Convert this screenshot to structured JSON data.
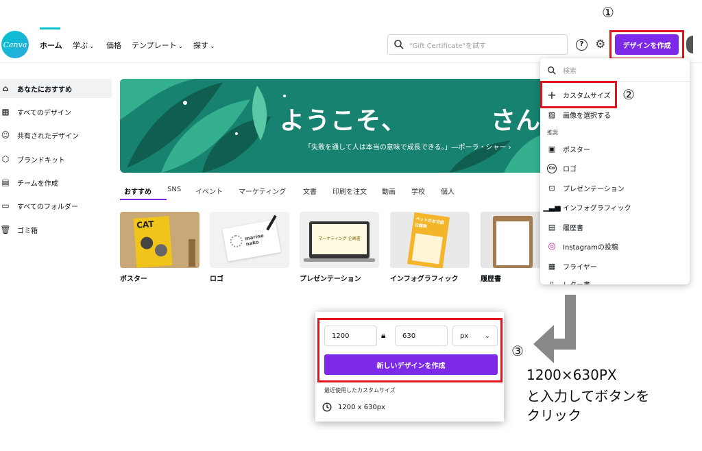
{
  "header": {
    "logo_text": "Canva",
    "nav": [
      {
        "label": "ホーム",
        "active": true
      },
      {
        "label": "学ぶ"
      },
      {
        "label": "価格"
      },
      {
        "label": "テンプレート"
      },
      {
        "label": "探す"
      }
    ],
    "search_placeholder": "\"Gift Certificate\"を試す",
    "help_label": "?",
    "create_button": "デザインを作成"
  },
  "sidebar": {
    "items": [
      {
        "label": "あなたにおすすめ",
        "icon": "home-icon",
        "active": true
      },
      {
        "label": "すべてのデザイン",
        "icon": "grid-icon"
      },
      {
        "label": "共有されたデザイン",
        "icon": "people-icon"
      },
      {
        "label": "ブランドキット",
        "icon": "brand-icon"
      },
      {
        "label": "チームを作成",
        "icon": "building-icon"
      },
      {
        "label": "すべてのフォルダー",
        "icon": "folder-icon"
      },
      {
        "label": "ゴミ箱",
        "icon": "trash-icon"
      }
    ]
  },
  "hero": {
    "title": "ようこそ、",
    "name": "さん",
    "quote": "「失敗を通して人は本当の意味で成長できる。」―ポーラ・シャー ›"
  },
  "tabs": [
    "おすすめ",
    "SNS",
    "イベント",
    "マーケティング",
    "文書",
    "印刷を注文",
    "動画",
    "学校",
    "個人"
  ],
  "cards": [
    "ポスター",
    "ロゴ",
    "プレゼンテーション",
    "インフォグラフィック",
    "履歴書"
  ],
  "card_texts": {
    "poster": "CAT",
    "logo": "marine nako",
    "presentation": "マーケティング 企画書",
    "infographic": "ペットのお世話 日課表"
  },
  "dropdown": {
    "search_placeholder": "検索",
    "custom_size": "カスタムサイズ",
    "select_image": "画像を選択する",
    "section": "推奨",
    "items": [
      {
        "label": "ポスター",
        "icon": "poster-icon"
      },
      {
        "label": "ロゴ",
        "icon": "co-icon"
      },
      {
        "label": "プレゼンテーション",
        "icon": "presentation-icon"
      },
      {
        "label": "インフォグラフィック",
        "icon": "bar-chart-icon"
      },
      {
        "label": "履歴書",
        "icon": "resume-icon"
      },
      {
        "label": "Instagramの投稿",
        "icon": "instagram-icon"
      },
      {
        "label": "フライヤー",
        "icon": "flyer-icon"
      },
      {
        "label": "レター書",
        "icon": "doc-icon"
      }
    ]
  },
  "custom_panel": {
    "width": "1200",
    "height": "630",
    "unit": "px",
    "create_button": "新しいデザインを作成",
    "recent_title": "最近使用したカスタムサイズ",
    "recent_item": "1200 x 630px"
  },
  "annotations": {
    "step1": "①",
    "step2": "②",
    "step3": "③",
    "instruction": [
      "1200×630PX",
      "と入力してボタンを",
      "クリック"
    ]
  },
  "colors": {
    "accent": "#7d2ae8",
    "highlight": "#e0121c",
    "hero": "#17826f",
    "logo": "#00c4cc"
  }
}
